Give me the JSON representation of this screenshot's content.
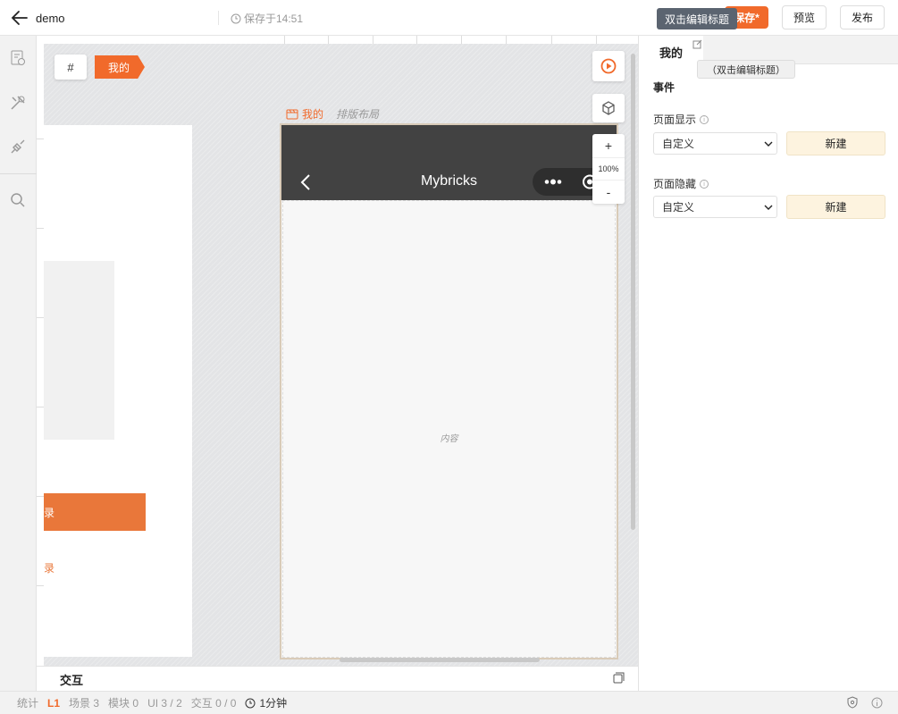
{
  "topbar": {
    "app_name": "demo",
    "saved_text": "保存于14:51",
    "tooltip": "双击编辑标题",
    "save_label": "保存*",
    "preview_label": "预览",
    "publish_label": "发布"
  },
  "canvas": {
    "hash_label": "#",
    "scene_tag": "我的",
    "frame_name": "我的",
    "frame_layout": "排版布局",
    "phone_title": "Mybricks",
    "content_placeholder": "内容",
    "zoom_in": "+",
    "zoom_level": "100%",
    "zoom_out": "-",
    "left_page_char": "录"
  },
  "interaction": {
    "title": "交互"
  },
  "right_panel": {
    "tab_title": "我的",
    "tip": "（双击编辑标题）",
    "events_title": "事件",
    "events": [
      {
        "label": "页面显示",
        "select_value": "自定义",
        "button": "新建"
      },
      {
        "label": "页面隐藏",
        "select_value": "自定义",
        "button": "新建"
      }
    ]
  },
  "statusbar": {
    "stats": "统计",
    "level": "L1",
    "scenes": "场景 3",
    "modules": "模块 0",
    "ui": "UI 3 / 2",
    "interactions": "交互 0 / 0",
    "time": "1分钟"
  },
  "colors": {
    "accent": "#f16a2b",
    "phone_header": "#424242",
    "new_button": "#fdf3df"
  }
}
